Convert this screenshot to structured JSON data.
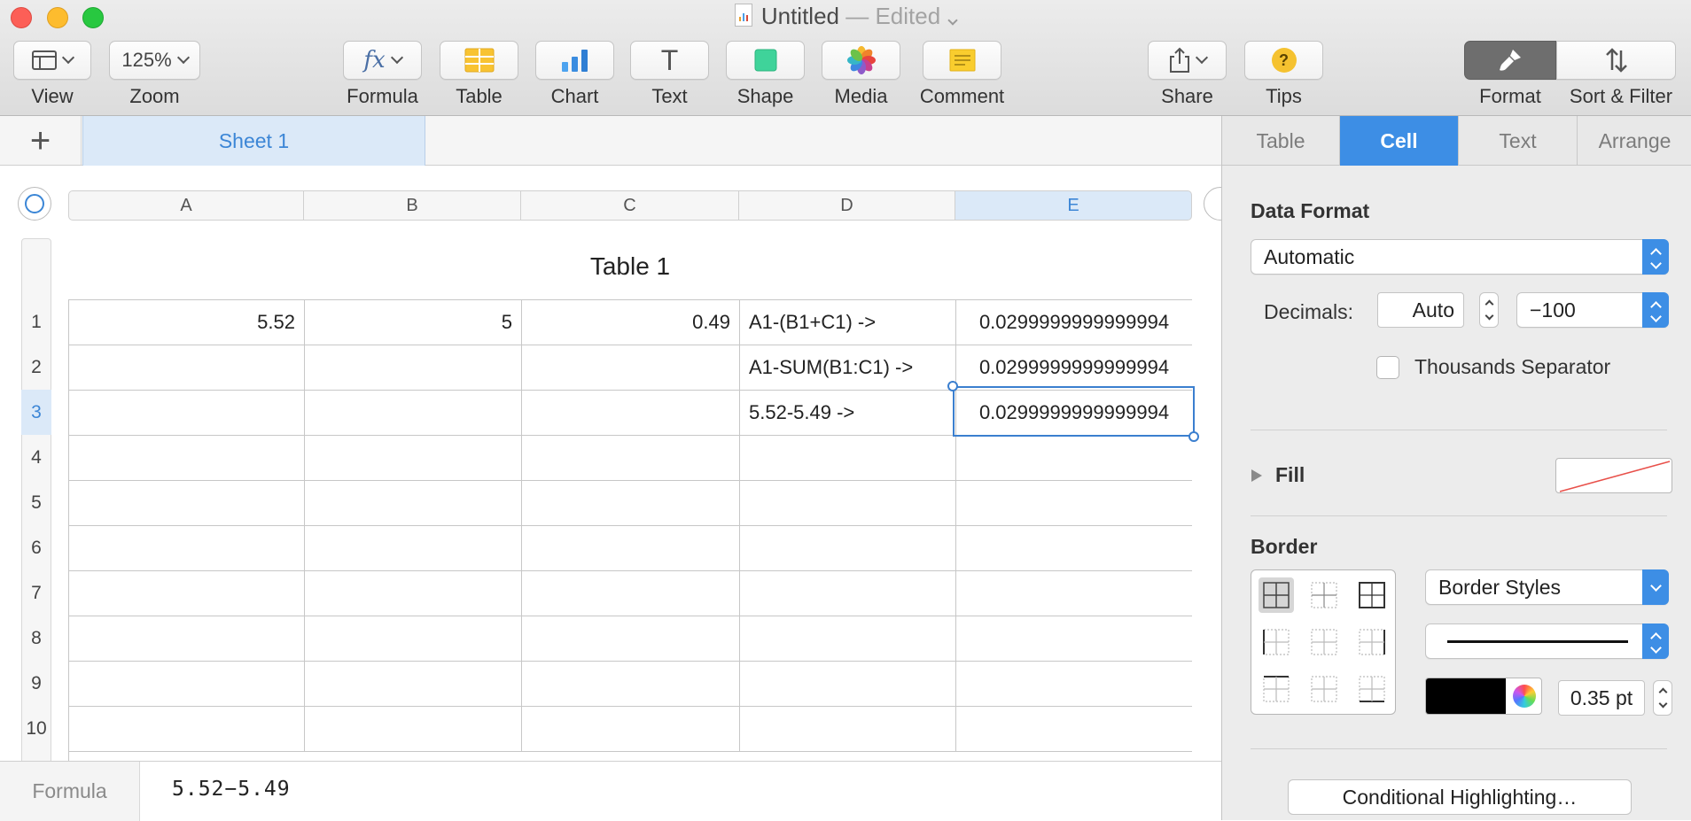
{
  "window": {
    "title": "Untitled",
    "edited": "— Edited"
  },
  "toolbar": {
    "view_label": "View",
    "zoom_value": "125%",
    "zoom_label": "Zoom",
    "formula_icon": "fx",
    "formula_label": "Formula",
    "table_label": "Table",
    "chart_label": "Chart",
    "text_icon": "T",
    "text_label": "Text",
    "shape_label": "Shape",
    "media_label": "Media",
    "comment_label": "Comment",
    "share_label": "Share",
    "tips_icon": "?",
    "tips_label": "Tips",
    "format_label": "Format",
    "sort_label": "Sort & Filter"
  },
  "sheets": {
    "add_icon": "+",
    "active": "Sheet 1"
  },
  "table": {
    "title": "Table 1",
    "columns": [
      "A",
      "B",
      "C",
      "D",
      "E"
    ],
    "selected_column": "E",
    "selected_row": "3",
    "row_numbers": [
      "1",
      "2",
      "3",
      "4",
      "5",
      "6",
      "7",
      "8",
      "9",
      "10"
    ],
    "rows": [
      [
        "5.52",
        "5",
        "0.49",
        "A1-(B1+C1) ->",
        "0.0299999999999994"
      ],
      [
        "",
        "",
        "",
        "A1-SUM(B1:C1) ->",
        "0.0299999999999994"
      ],
      [
        "",
        "",
        "",
        "5.52-5.49 ->",
        "0.0299999999999994"
      ],
      [
        "",
        "",
        "",
        "",
        ""
      ],
      [
        "",
        "",
        "",
        "",
        ""
      ],
      [
        "",
        "",
        "",
        "",
        ""
      ],
      [
        "",
        "",
        "",
        "",
        ""
      ],
      [
        "",
        "",
        "",
        "",
        ""
      ],
      [
        "",
        "",
        "",
        "",
        ""
      ],
      [
        "",
        "",
        "",
        "",
        ""
      ]
    ]
  },
  "formula_bar": {
    "label": "Formula",
    "value": "5.52−5.49"
  },
  "inspector": {
    "tabs": [
      "Table",
      "Cell",
      "Text",
      "Arrange"
    ],
    "active_tab": "Cell",
    "data_format_title": "Data Format",
    "data_format_value": "Automatic",
    "decimals_label": "Decimals:",
    "decimals_value": "Auto",
    "negative_format": "−100",
    "thousands_label": "Thousands Separator",
    "fill_label": "Fill",
    "border_title": "Border",
    "border_styles": "Border Styles",
    "border_width": "0.35 pt",
    "border_color": "#000000",
    "conditional_label": "Conditional Highlighting…"
  },
  "colors": {
    "accent": "#3d8ee5",
    "selection": "#dbe9f8"
  }
}
